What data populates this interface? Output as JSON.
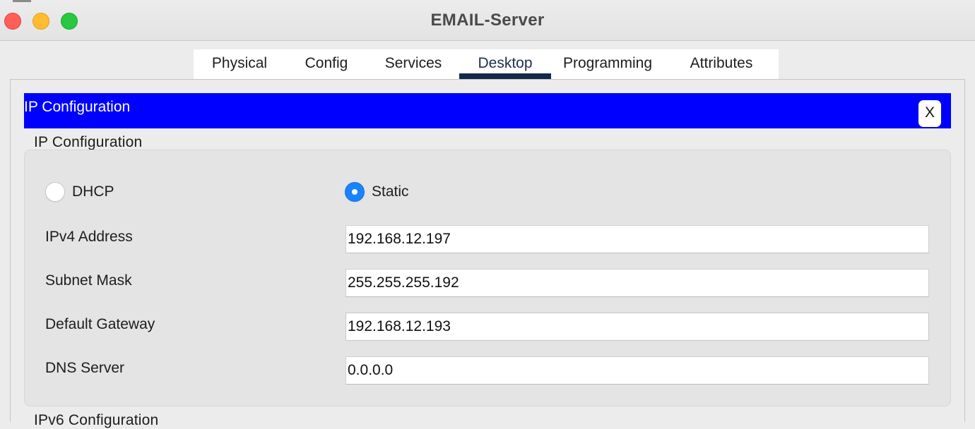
{
  "window": {
    "title": "EMAIL-Server"
  },
  "tabs": [
    {
      "label": "Physical",
      "active": false
    },
    {
      "label": "Config",
      "active": false
    },
    {
      "label": "Services",
      "active": false
    },
    {
      "label": "Desktop",
      "active": true
    },
    {
      "label": "Programming",
      "active": false
    },
    {
      "label": "Attributes",
      "active": false
    }
  ],
  "app": {
    "header_title": "IP Configuration",
    "close_label": "X",
    "header_color": "#0000ff"
  },
  "ipv4": {
    "section_title": "IP Configuration",
    "mode_options": [
      {
        "label": "DHCP",
        "selected": false
      },
      {
        "label": "Static",
        "selected": true
      }
    ],
    "fields": [
      {
        "label": "IPv4 Address",
        "value": "192.168.12.197"
      },
      {
        "label": "Subnet Mask",
        "value": "255.255.255.192"
      },
      {
        "label": "Default Gateway",
        "value": "192.168.12.193"
      },
      {
        "label": "DNS Server",
        "value": "0.0.0.0"
      }
    ]
  },
  "ipv6": {
    "section_title": "IPv6 Configuration"
  },
  "colors": {
    "radio_selected": "#1a82fb",
    "active_tab_indicator": "#13294a"
  }
}
